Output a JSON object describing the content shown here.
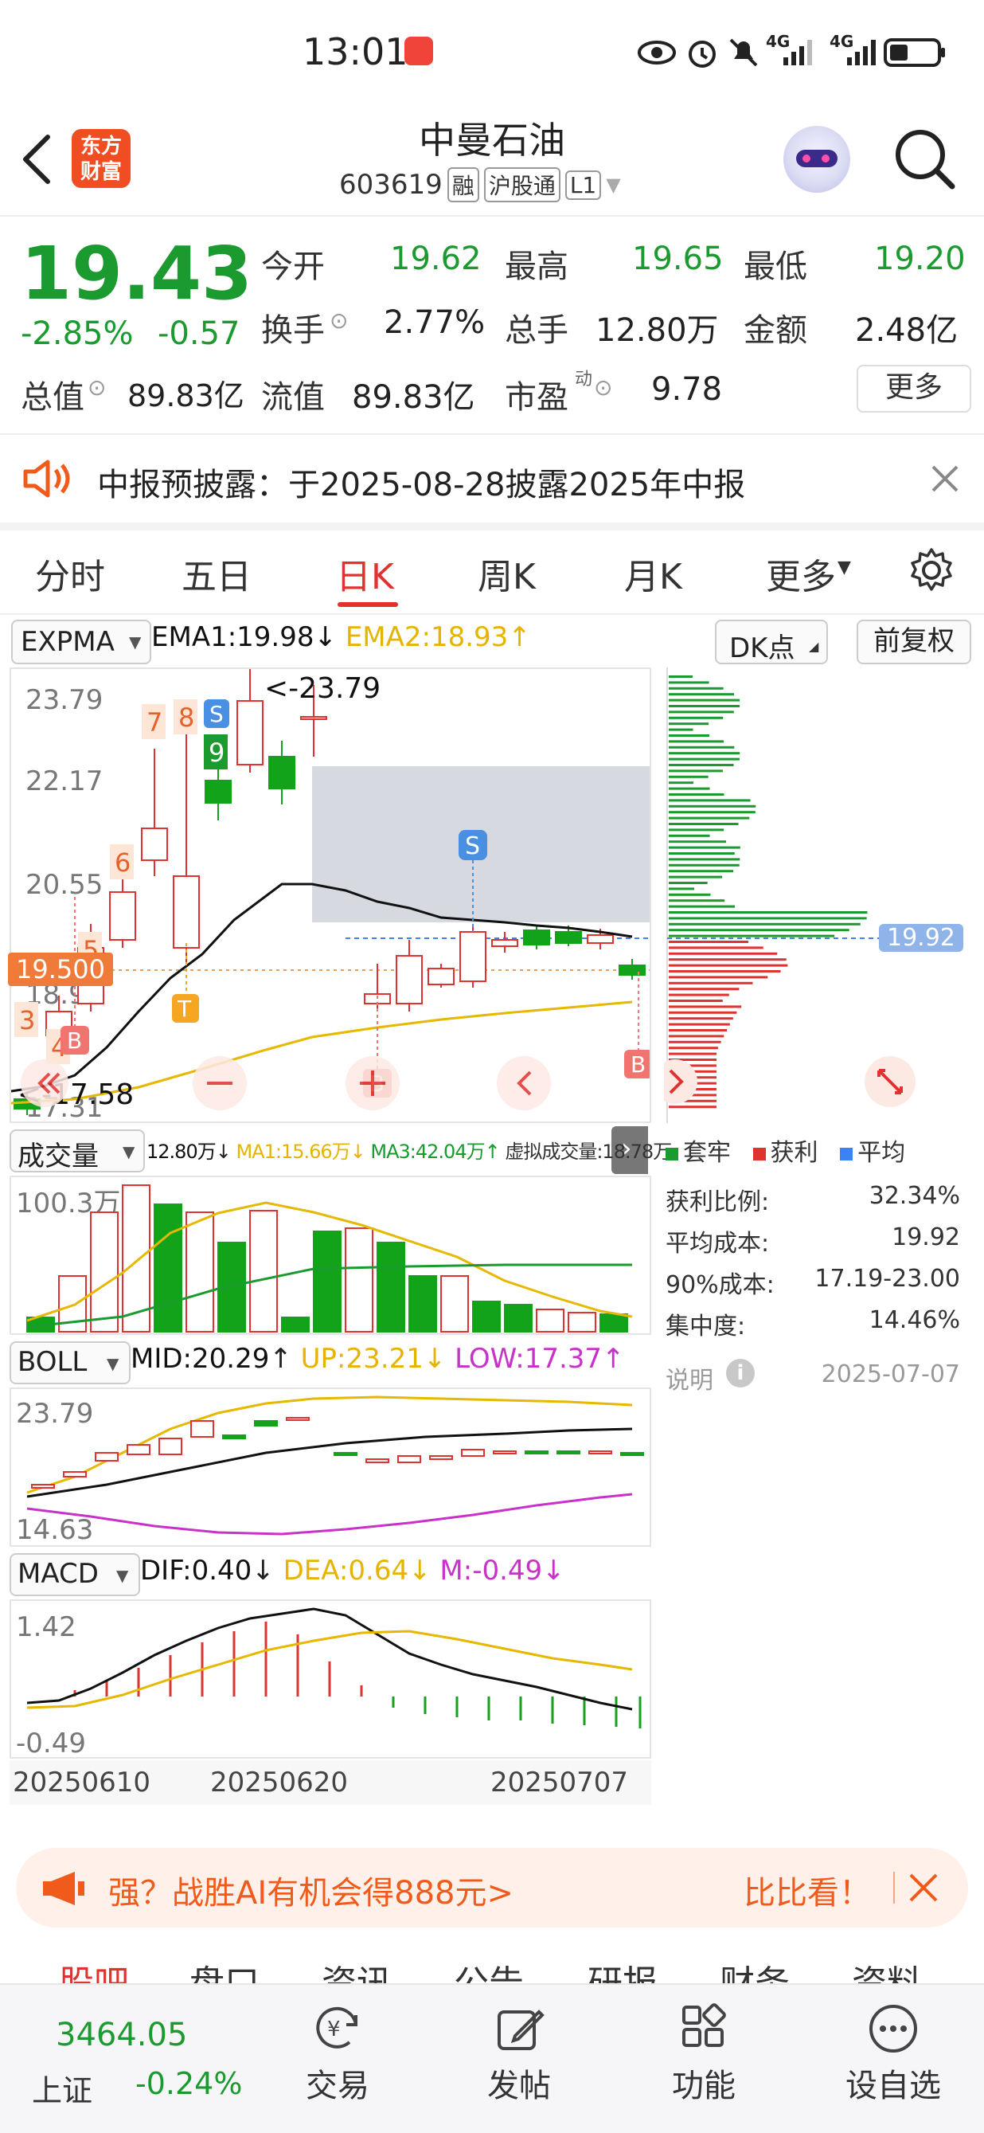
{
  "status_bar": {
    "time": "13:01",
    "network1": "4G",
    "network2": "4G"
  },
  "header": {
    "logo_line1": "东方",
    "logo_line2": "财富",
    "stock_name": "中曼石油",
    "stock_code": "603619",
    "tags": [
      "融",
      "沪股通",
      "L1"
    ]
  },
  "quote": {
    "price": "19.43",
    "change_pct": "-2.85%",
    "change": "-0.57",
    "open_label": "今开",
    "open": "19.62",
    "high_label": "最高",
    "high": "19.65",
    "low_label": "最低",
    "low": "19.20",
    "turnover_label": "换手",
    "turnover": "2.77%",
    "volume_label": "总手",
    "volume": "12.80万",
    "amount_label": "金额",
    "amount": "2.48亿",
    "mcap_label": "总值",
    "mcap": "89.83亿",
    "float_label": "流值",
    "float": "89.83亿",
    "pe_label": "市盈",
    "pe_sup": "动",
    "pe": "9.78",
    "more_button": "更多"
  },
  "notice": {
    "text": "中报预披露：于2025-08-28披露2025年中报"
  },
  "tabs": [
    {
      "label": "分时"
    },
    {
      "label": "五日"
    },
    {
      "label": "日K"
    },
    {
      "label": "周K"
    },
    {
      "label": "月K"
    },
    {
      "label": "更多"
    }
  ],
  "kline": {
    "indicator": "EXPMA",
    "ema1": "EMA1:19.98",
    "ema1_arrow": "↓",
    "ema2": "EMA2:18.93",
    "ema2_arrow": "↑",
    "dk_button": "DK点",
    "adjust_button": "前复权",
    "y_labels": [
      "23.79",
      "22.17",
      "20.55",
      "18.93",
      "17.31"
    ],
    "max_annot": "<-23.79",
    "min_annot": "<-17.58",
    "current_price_tag": "19.500",
    "buy_marker": "B",
    "sell_marker": "S",
    "t_marker": "T",
    "count_markers": [
      "3",
      "4",
      "5",
      "6",
      "7",
      "8",
      "9"
    ],
    "colors": {
      "up": "#e0322f",
      "down": "#12a31b",
      "ema1": "#111111",
      "ema2": "#e6b800",
      "box": "#c8ccd4"
    }
  },
  "chip": {
    "avg_price_tag": "19.92",
    "legend": [
      "套牢",
      "获利",
      "平均"
    ],
    "rows": [
      {
        "label": "获利比例:",
        "value": "32.34%"
      },
      {
        "label": "平均成本:",
        "value": "19.92"
      },
      {
        "label": "90%成本:",
        "value": "17.19-23.00"
      },
      {
        "label": "集中度:",
        "value": "14.46%"
      }
    ],
    "note_label": "说明",
    "date": "2025-07-07"
  },
  "volume": {
    "indicator": "成交量",
    "total": "12.80万",
    "total_arrow": "↓",
    "ma1": "MA1:15.66万",
    "ma1_arrow": "↓",
    "ma3": "MA3:42.04万",
    "ma3_arrow": "↑",
    "virtual": "虚拟成交量:18.78万",
    "y_label": "100.3万"
  },
  "boll": {
    "indicator": "BOLL",
    "mid": "MID:20.29",
    "mid_arrow": "↑",
    "up": "UP:23.21",
    "up_arrow": "↓",
    "low": "LOW:17.37",
    "low_arrow": "↑",
    "y_top": "23.79",
    "y_bottom": "14.63"
  },
  "macd": {
    "indicator": "MACD",
    "dif": "DIF:0.40",
    "dif_arrow": "↓",
    "dea": "DEA:0.64",
    "dea_arrow": "↓",
    "m": "M:-0.49",
    "m_arrow": "↓",
    "y_top": "1.42",
    "y_bottom": "-0.49",
    "dates": [
      "20250610",
      "20250620",
      "20250707"
    ]
  },
  "banner": {
    "left_text": "强？战胜AI有机会得888元>",
    "right_text": "比比看！"
  },
  "section_tabs": [
    "股吧",
    "盘口",
    "资讯",
    "公告",
    "研报",
    "财务",
    "资料"
  ],
  "bottom_nav": {
    "index_value": "3464.05",
    "index_name": "上证",
    "index_change": "-0.24%",
    "items": [
      {
        "label": "交易"
      },
      {
        "label": "发帖"
      },
      {
        "label": "功能"
      },
      {
        "label": "设自选"
      }
    ]
  }
}
